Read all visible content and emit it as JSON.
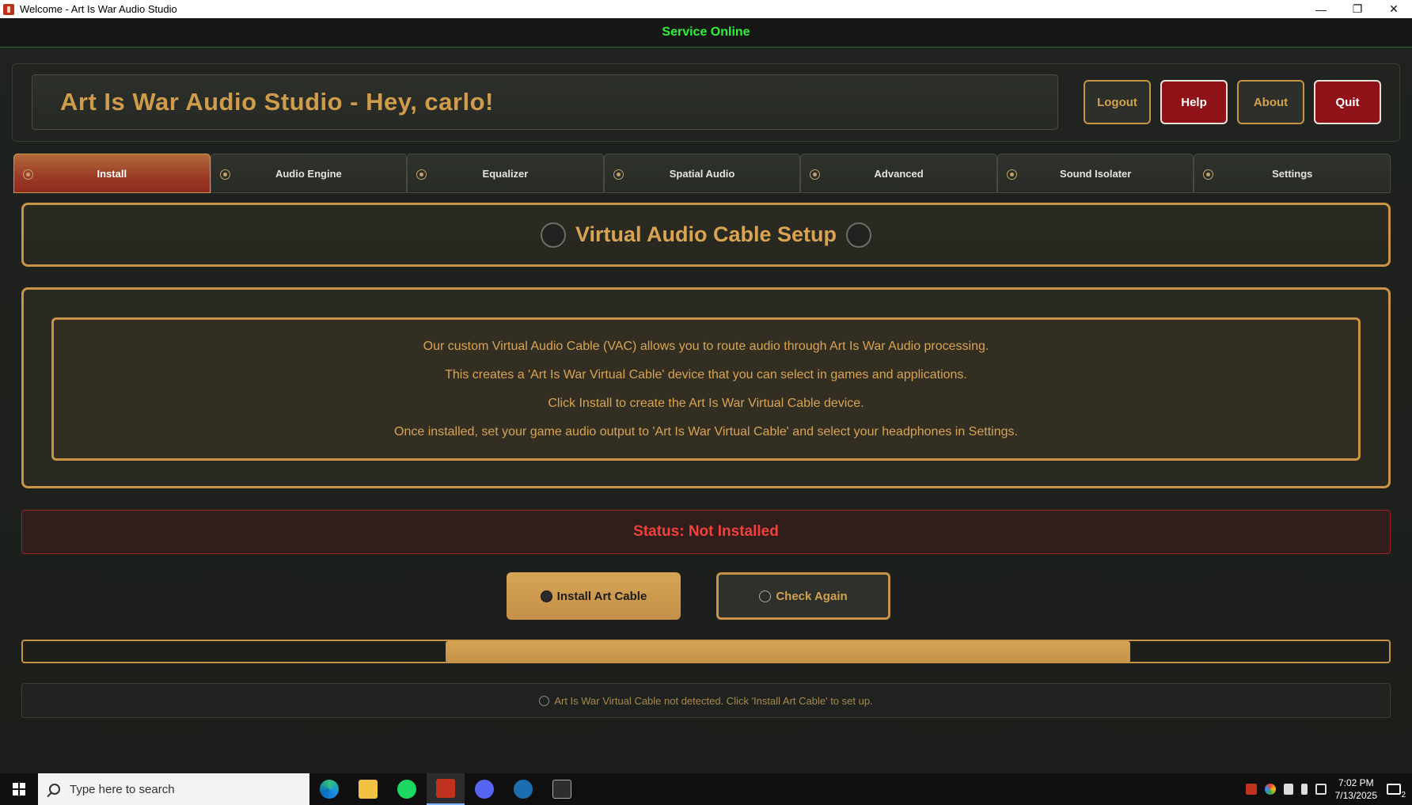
{
  "window": {
    "title": "Welcome - Art Is War Audio Studio",
    "controls": {
      "minimize": "—",
      "restore": "❐",
      "close": "✕"
    }
  },
  "service": {
    "status": "Service Online",
    "color": "#2df23a"
  },
  "header": {
    "title": "Art Is War Audio Studio - Hey, carlo!",
    "buttons": {
      "logout": "Logout",
      "help": "Help",
      "about": "About",
      "quit": "Quit"
    }
  },
  "tabs": [
    {
      "label": "Install",
      "active": true
    },
    {
      "label": "Audio Engine",
      "active": false
    },
    {
      "label": "Equalizer",
      "active": false
    },
    {
      "label": "Spatial Audio",
      "active": false
    },
    {
      "label": "Advanced",
      "active": false
    },
    {
      "label": "Sound Isolater",
      "active": false
    },
    {
      "label": "Settings",
      "active": false
    }
  ],
  "section": {
    "title": "Virtual Audio Cable Setup"
  },
  "info": {
    "lines": [
      "Our custom Virtual Audio Cable (VAC) allows you to route audio through Art Is War Audio processing.",
      "This creates a 'Art Is War Virtual Cable' device that you can select in games and applications.",
      "Click Install to create the Art Is War Virtual Cable device.",
      "Once installed, set your game audio output to 'Art Is War Virtual Cable' and select your headphones in Settings."
    ]
  },
  "status": {
    "text": "Status: Not Installed",
    "color": "#f2403a"
  },
  "actions": {
    "install": "Install Art Cable",
    "check": "Check Again"
  },
  "progress": {
    "fill_start": 0.31,
    "fill_end": 0.81
  },
  "message": {
    "text": "Art Is War Virtual Cable not detected. Click 'Install Art Cable' to set up."
  },
  "colors": {
    "accent": "#c79344",
    "danger": "#8e1218"
  },
  "taskbar": {
    "search_placeholder": "Type here to search",
    "time": "7:02 PM",
    "date": "7/13/2025",
    "notification_count": "2",
    "apps": [
      "edge-icon",
      "file-explorer-icon",
      "spotify-icon",
      "art-is-war-icon",
      "discord-icon",
      "steam-icon",
      "epic-games-icon"
    ]
  }
}
